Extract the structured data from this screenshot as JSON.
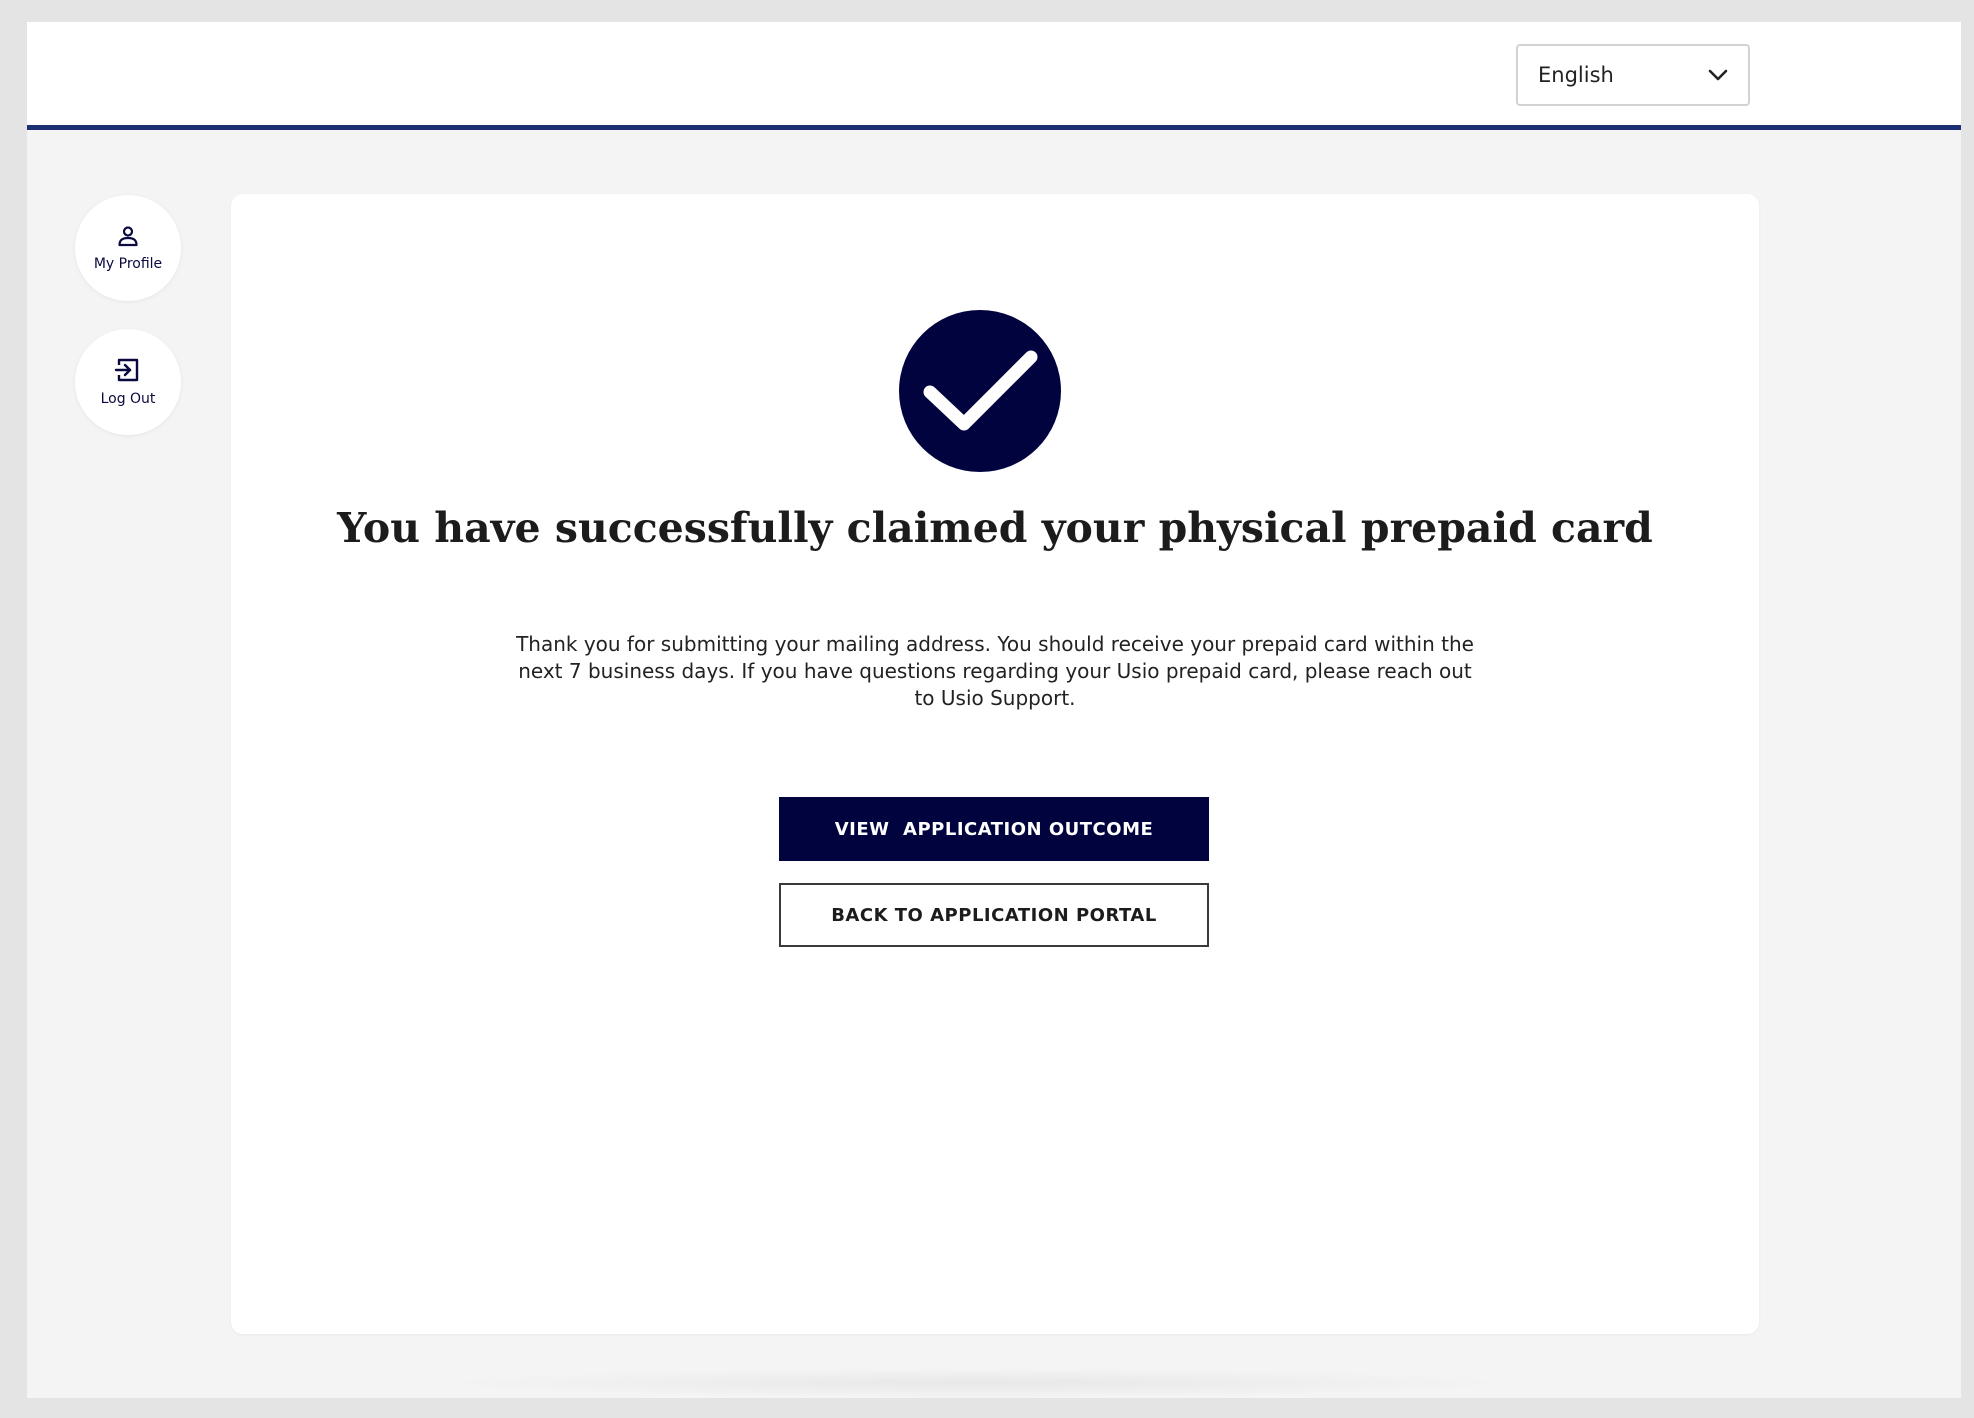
{
  "header": {
    "language": {
      "selected": "English",
      "icon": "chevron-down-icon"
    }
  },
  "sidebar": {
    "items": [
      {
        "label": "My Profile",
        "icon": "user-icon"
      },
      {
        "label": "Log Out",
        "icon": "logout-icon"
      }
    ]
  },
  "main": {
    "status_icon": "checkmark-circle-icon",
    "title": "You have successfully claimed your physical prepaid card",
    "message": "Thank you for submitting your mailing address. You should receive your prepaid card within the next 7 business days. If you have questions regarding your Usio prepaid card, please reach out to Usio Support.",
    "primary_button": "VIEW  APPLICATION OUTCOME",
    "secondary_button": "BACK TO APPLICATION PORTAL"
  },
  "colors": {
    "brand_navy": "#00033e",
    "header_rule": "#1b2f72",
    "page_bg": "#f4f4f4"
  }
}
